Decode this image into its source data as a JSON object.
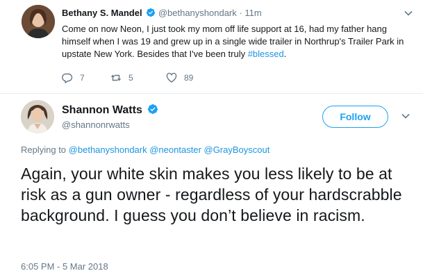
{
  "colors": {
    "link_blue": "#1b95e0",
    "follow_blue": "#1da1f2",
    "text": "#14171a",
    "muted": "#657786",
    "divider": "#e6ecf0"
  },
  "reply_tweet": {
    "name": "Bethany S. Mandel",
    "handle": "@bethanyshondark",
    "separator": "·",
    "time": "11m",
    "verified_icon": "verified-badge-icon",
    "body_text": "Come on now Neon, I just took my mom off life support at 16, had my father hang himself when I was 19 and grew up in a single wide trailer in Northrup's Trailer Park in upstate New York. Besides that I've been truly ",
    "hashtag": "#blessed",
    "body_end": ".",
    "actions": {
      "reply_count": "7",
      "retweet_count": "5",
      "like_count": "89"
    }
  },
  "main_tweet": {
    "name": "Shannon Watts",
    "handle": "@shannonrwatts",
    "follow_label": "Follow",
    "replying_prefix": "Replying to",
    "mentions": [
      "@bethanyshondark",
      "@neontaster",
      "@GrayBoyscout"
    ],
    "text": "Again, your white skin makes you less likely to be at risk as a gun owner - regardless of your hardscrabble background. I guess you don’t believe in racism.",
    "timestamp": "6:05 PM - 5 Mar 2018"
  }
}
